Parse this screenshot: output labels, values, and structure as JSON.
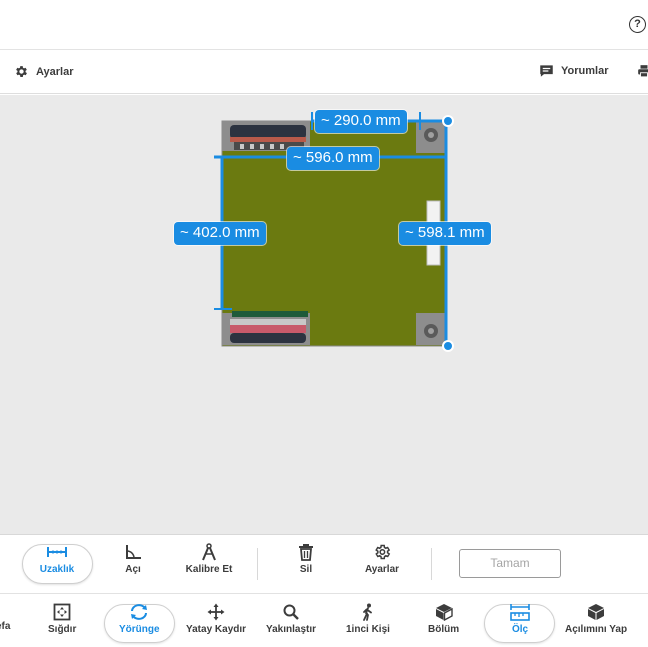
{
  "header": {
    "help_label": "?"
  },
  "toolbar": {
    "settings_label": "Ayarlar",
    "comments_label": "Yorumlar"
  },
  "measurements": [
    {
      "label": "~ 290.0 mm"
    },
    {
      "label": "~ 596.0 mm"
    },
    {
      "label": "~ 402.0 mm"
    },
    {
      "label": "~ 598.1 mm"
    }
  ],
  "measure_toolbar": {
    "distance": "Uzaklık",
    "angle": "Açı",
    "calibrate": "Kalibre Et",
    "delete": "Sil",
    "settings": "Ayarlar",
    "done": "Tamam"
  },
  "nav_toolbar": {
    "partial_left": "efa",
    "fit": "Sığdır",
    "orbit": "Yörünge",
    "pan": "Yatay Kaydır",
    "zoom": "Yakınlaştır",
    "first_person": "1inci Kişi",
    "section": "Bölüm",
    "measure": "Ölç",
    "explode": "Açılımını Yap"
  },
  "colors": {
    "accent": "#1a8ce2",
    "board_green": "#6b7a10",
    "viewport_bg": "#eaeaea"
  }
}
